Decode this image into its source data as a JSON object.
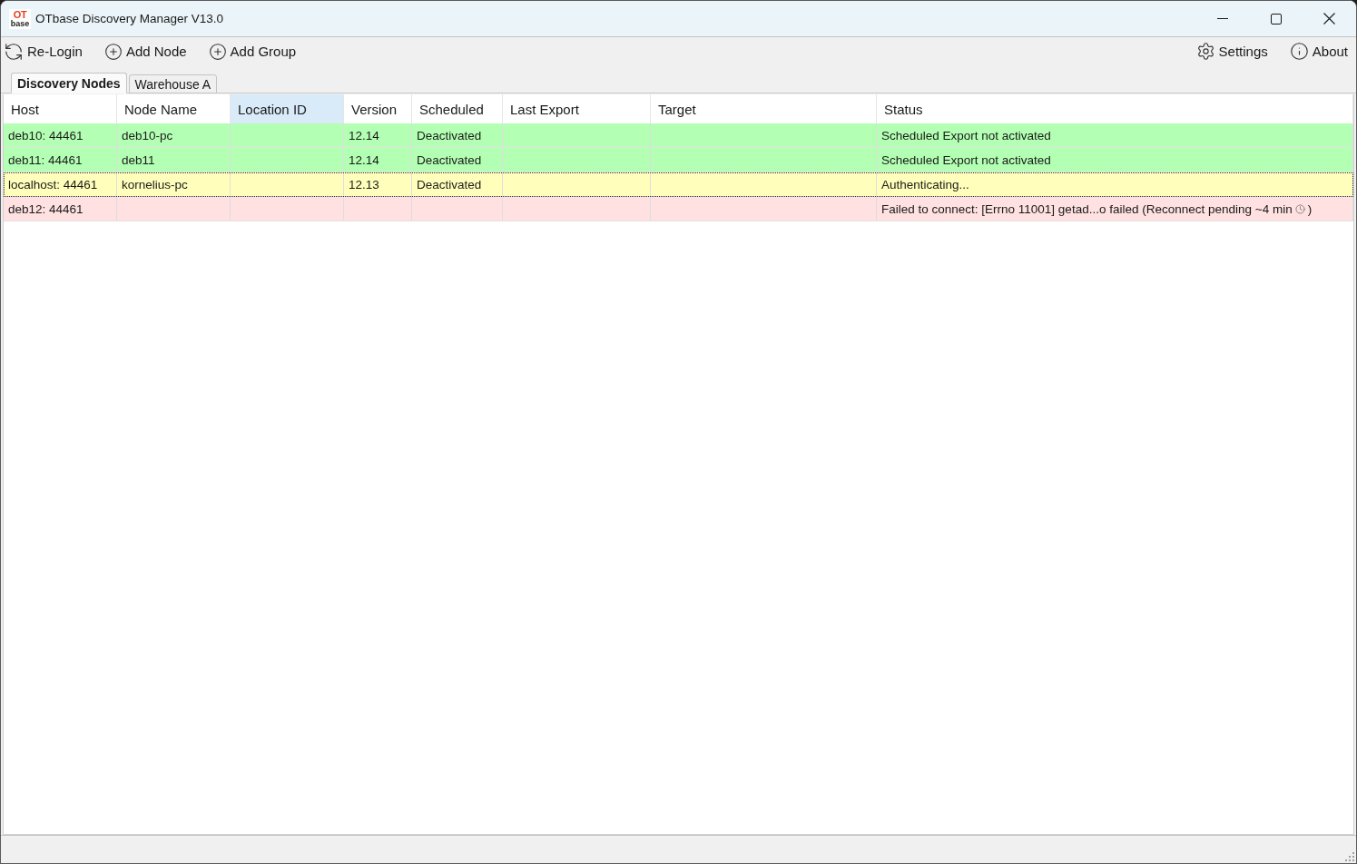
{
  "window": {
    "app_icon": {
      "line_1": "OT",
      "line_2": "base"
    },
    "title": "OTbase Discovery Manager V13.0"
  },
  "toolbar": {
    "left": [
      {
        "label": "Re-Login",
        "kind": "refresh"
      },
      {
        "label": "Add Node",
        "kind": "add"
      },
      {
        "label": "Add Group",
        "kind": "add"
      }
    ],
    "right": [
      {
        "label": "Settings",
        "kind": "settings"
      },
      {
        "label": "About",
        "kind": "info"
      }
    ]
  },
  "tabs": [
    {
      "label": "Discovery Nodes",
      "selected": true
    },
    {
      "label": "Warehouse A",
      "selected": false
    }
  ],
  "table": {
    "columns": [
      {
        "label": "Host",
        "highlighted": false
      },
      {
        "label": "Node Name",
        "highlighted": false
      },
      {
        "label": "Location ID",
        "highlighted": true
      },
      {
        "label": "Version",
        "highlighted": false
      },
      {
        "label": "Scheduled",
        "highlighted": false
      },
      {
        "label": "Last Export",
        "highlighted": false
      },
      {
        "label": "Target",
        "highlighted": false
      },
      {
        "label": "Status",
        "highlighted": false
      }
    ],
    "rows": [
      {
        "color": "#b3ffb3",
        "focused": false,
        "host": "deb10: 44461",
        "node_name": "deb10-pc",
        "version": "12.14",
        "scheduled": "Deactivated",
        "status": "Scheduled Export not activated"
      },
      {
        "color": "#b3ffb3",
        "focused": false,
        "host": "deb11: 44461",
        "node_name": "deb11",
        "version": "12.14",
        "scheduled": "Deactivated",
        "status": "Scheduled Export not activated"
      },
      {
        "color": "#ffffbb",
        "focused": true,
        "host": "localhost: 44461",
        "node_name": "kornelius-pc",
        "version": "12.13",
        "scheduled": "Deactivated",
        "status": "Authenticating..."
      },
      {
        "color": "#ffe1e1",
        "focused": false,
        "host": "deb12: 44461",
        "status": "Failed to connect: [Errno 11001] getad...o failed (Reconnect pending ~4 min",
        "status_end": ")"
      }
    ]
  }
}
